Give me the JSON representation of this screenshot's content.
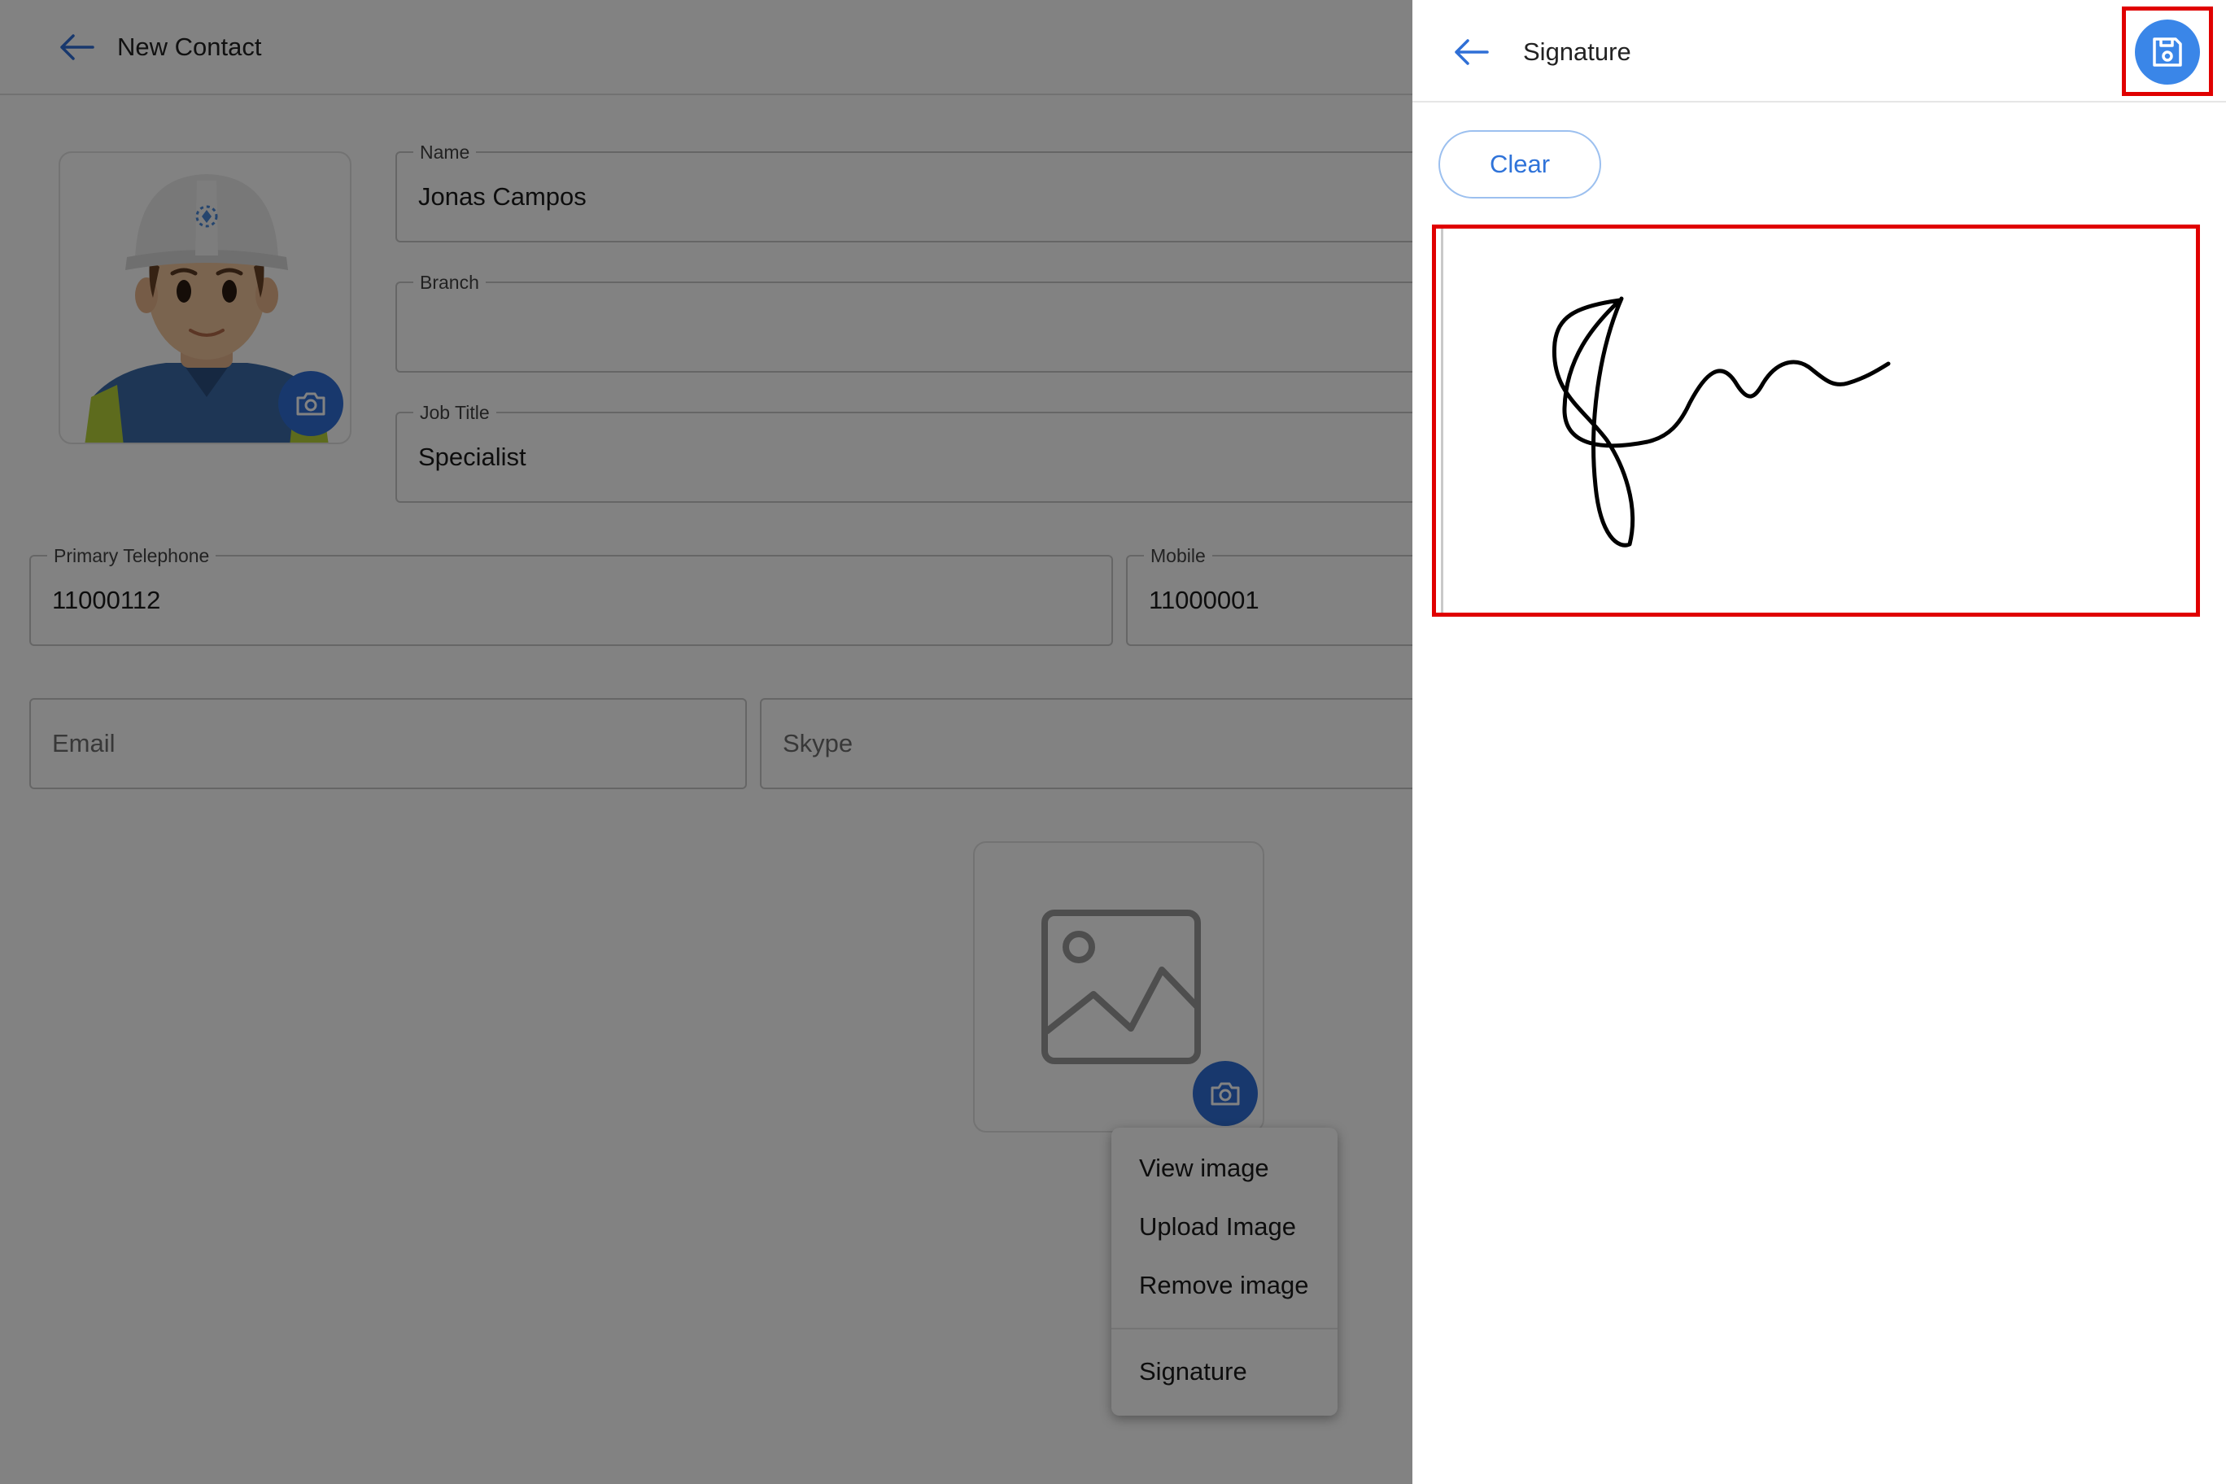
{
  "form": {
    "title": "New Contact",
    "fields": {
      "name": {
        "label": "Name",
        "value": "Jonas Campos"
      },
      "branch": {
        "label": "Branch",
        "value": ""
      },
      "job_title": {
        "label": "Job Title",
        "value": "Specialist"
      },
      "primary_telephone": {
        "label": "Primary Telephone",
        "value": "11000112"
      },
      "mobile": {
        "label": "Mobile",
        "value": "11000001"
      },
      "email": {
        "placeholder": "Email"
      },
      "skype": {
        "placeholder": "Skype"
      }
    }
  },
  "image_menu": {
    "items": [
      "View image",
      "Upload Image",
      "Remove image",
      "Signature"
    ]
  },
  "signature_panel": {
    "title": "Signature",
    "clear_label": "Clear",
    "save_icon": "floppy-disk-icon"
  },
  "colors": {
    "accent_blue": "#2f6fd6",
    "save_blue": "#3a86e8",
    "highlight_red": "#e00000",
    "overlay": "rgba(0,0,0,0.49)"
  }
}
